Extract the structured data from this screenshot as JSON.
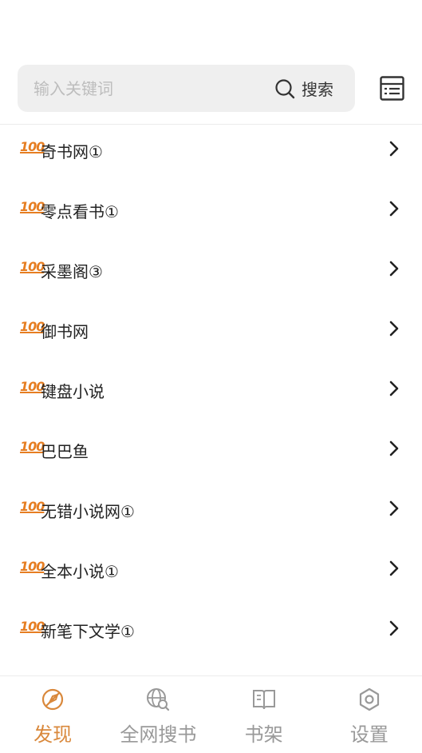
{
  "search": {
    "placeholder": "输入关键词",
    "button_label": "搜索"
  },
  "sources": [
    {
      "badge": "100",
      "name": "奇书网①"
    },
    {
      "badge": "100",
      "name": "零点看书①"
    },
    {
      "badge": "100",
      "name": "采墨阁③"
    },
    {
      "badge": "100",
      "name": "御书网"
    },
    {
      "badge": "100",
      "name": "键盘小说"
    },
    {
      "badge": "100",
      "name": "巴巴鱼"
    },
    {
      "badge": "100",
      "name": "无错小说网①"
    },
    {
      "badge": "100",
      "name": "全本小说①"
    },
    {
      "badge": "100",
      "name": "新笔下文学①"
    }
  ],
  "tabs": [
    {
      "label": "发现",
      "icon": "compass-icon",
      "active": true
    },
    {
      "label": "全网搜书",
      "icon": "globe-search-icon",
      "active": false
    },
    {
      "label": "书架",
      "icon": "book-icon",
      "active": false
    },
    {
      "label": "设置",
      "icon": "gear-icon",
      "active": false
    }
  ],
  "colors": {
    "accent": "#d9883b",
    "badge": "#e67e22",
    "inactive": "#999999",
    "search_bg": "#efefef"
  }
}
